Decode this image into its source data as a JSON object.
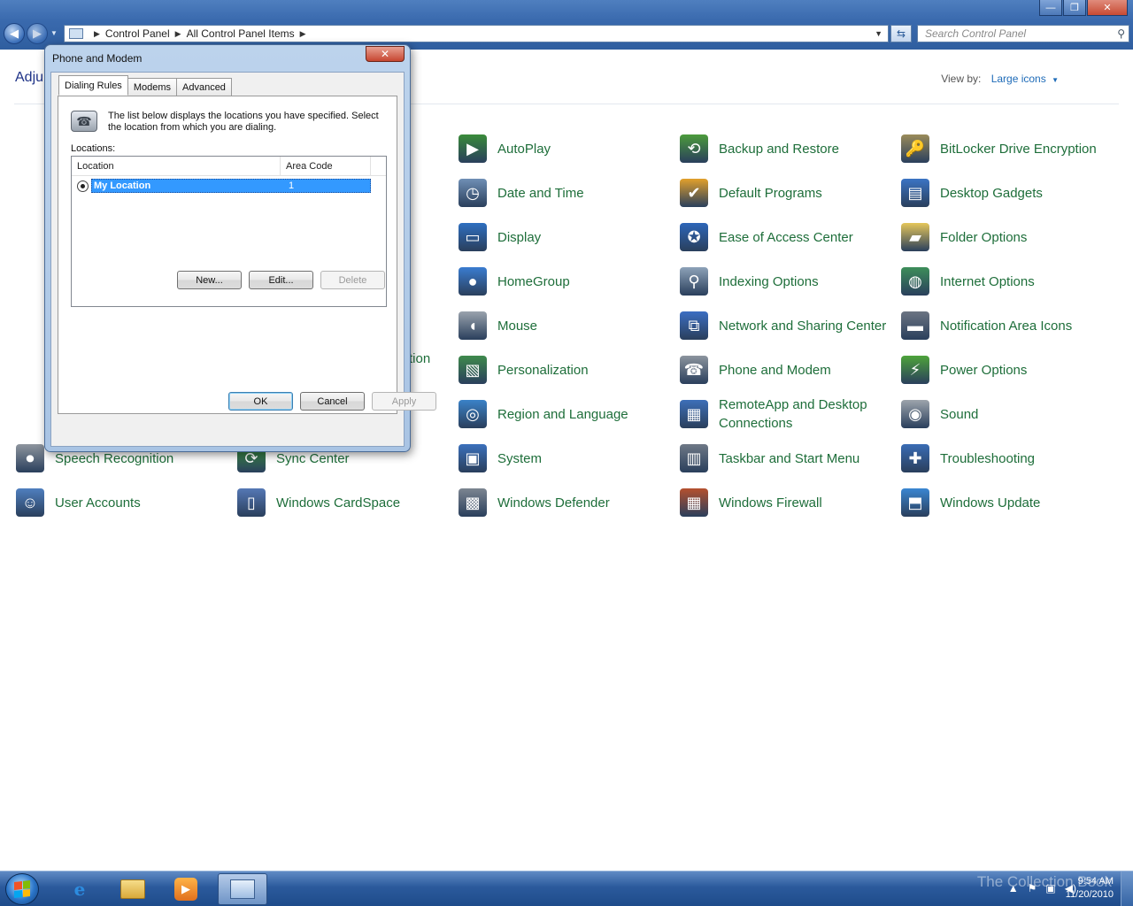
{
  "window": {
    "minimize": "—",
    "maximize": "❐",
    "close": "✕"
  },
  "address": {
    "crumbs": [
      "Control Panel",
      "All Control Panel Items"
    ],
    "search_placeholder": "Search Control Panel"
  },
  "content": {
    "heading": "Adju",
    "view_by_label": "View by:",
    "view_by_value": "Large icons",
    "items": [
      {
        "label": "AutoPlay",
        "icon": "autoplay-icon",
        "color": "#3a8b3a"
      },
      {
        "label": "Backup and Restore",
        "icon": "backup-icon",
        "color": "#4c9b3b"
      },
      {
        "label": "BitLocker Drive Encryption",
        "icon": "bitlocker-icon",
        "color": "#9a8b5a"
      },
      {
        "label": "Date and Time",
        "icon": "clock-icon",
        "color": "#6f8fb5"
      },
      {
        "label": "Default Programs",
        "icon": "default-programs-icon",
        "color": "#e2a02b"
      },
      {
        "label": "Desktop Gadgets",
        "icon": "gadgets-icon",
        "color": "#3b74c4"
      },
      {
        "label": "Display",
        "icon": "display-icon",
        "color": "#2e6fc0"
      },
      {
        "label": "Ease of Access Center",
        "icon": "ease-of-access-icon",
        "color": "#2d66b8"
      },
      {
        "label": "Folder Options",
        "icon": "folder-icon",
        "color": "#e5c65a"
      },
      {
        "label": "HomeGroup",
        "icon": "homegroup-icon",
        "color": "#3a7cd0"
      },
      {
        "label": "Indexing Options",
        "icon": "indexing-icon",
        "color": "#8da2b8"
      },
      {
        "label": "Internet Options",
        "icon": "internet-icon",
        "color": "#3d8e5a"
      },
      {
        "label": "Mouse",
        "icon": "mouse-icon",
        "color": "#9aa3ad"
      },
      {
        "label": "Network and Sharing Center",
        "icon": "network-icon",
        "color": "#3b6ec2"
      },
      {
        "label": "Notification Area Icons",
        "icon": "notification-icon",
        "color": "#6b7482"
      },
      {
        "label": "Personalization",
        "icon": "personalization-icon",
        "color": "#3f8a4c"
      },
      {
        "label": "Phone and Modem",
        "icon": "phone-icon",
        "color": "#8c949e"
      },
      {
        "label": "Power Options",
        "icon": "power-icon",
        "color": "#4ea33a"
      },
      {
        "label": "Region and Language",
        "icon": "region-icon",
        "color": "#3a82c8"
      },
      {
        "label": "RemoteApp and Desktop Connections",
        "icon": "remoteapp-icon",
        "color": "#3d6fb8"
      },
      {
        "label": "Sound",
        "icon": "sound-icon",
        "color": "#9da4ac"
      },
      {
        "label": "System",
        "icon": "system-icon",
        "color": "#3b70bb"
      },
      {
        "label": "Taskbar and Start Menu",
        "icon": "taskbar-icon",
        "color": "#6e7886"
      },
      {
        "label": "Troubleshooting",
        "icon": "troubleshooting-icon",
        "color": "#3a6cb4"
      },
      {
        "label": "Speech Recognition",
        "icon": "microphone-icon",
        "color": "#8e959e"
      },
      {
        "label": "Sync Center",
        "icon": "sync-icon",
        "color": "#3c9a3c"
      },
      {
        "label": "User Accounts",
        "icon": "user-accounts-icon",
        "color": "#4f7fbf"
      },
      {
        "label": "Windows CardSpace",
        "icon": "cardspace-icon",
        "color": "#5578b5"
      },
      {
        "label": "Windows Defender",
        "icon": "defender-icon",
        "color": "#7c8591"
      },
      {
        "label": "Windows Firewall",
        "icon": "firewall-icon",
        "color": "#b5502e"
      },
      {
        "label": "Windows Update",
        "icon": "windows-update-icon",
        "color": "#3a86d2"
      }
    ],
    "partial_text": "tion"
  },
  "dialog": {
    "title": "Phone and Modem",
    "tabs": [
      "Dialing Rules",
      "Modems",
      "Advanced"
    ],
    "description": "The list below displays the locations you have specified. Select the location from which you are dialing.",
    "locations_label": "Locations:",
    "columns": [
      "Location",
      "Area Code"
    ],
    "rows": [
      {
        "location": "My Location",
        "area_code": "1"
      }
    ],
    "buttons": {
      "new": "New...",
      "edit": "Edit...",
      "delete": "Delete",
      "ok": "OK",
      "cancel": "Cancel",
      "apply": "Apply"
    }
  },
  "taskbar": {
    "time": "9:54 AM",
    "date": "11/20/2010",
    "watermark": "The Collection Book"
  }
}
